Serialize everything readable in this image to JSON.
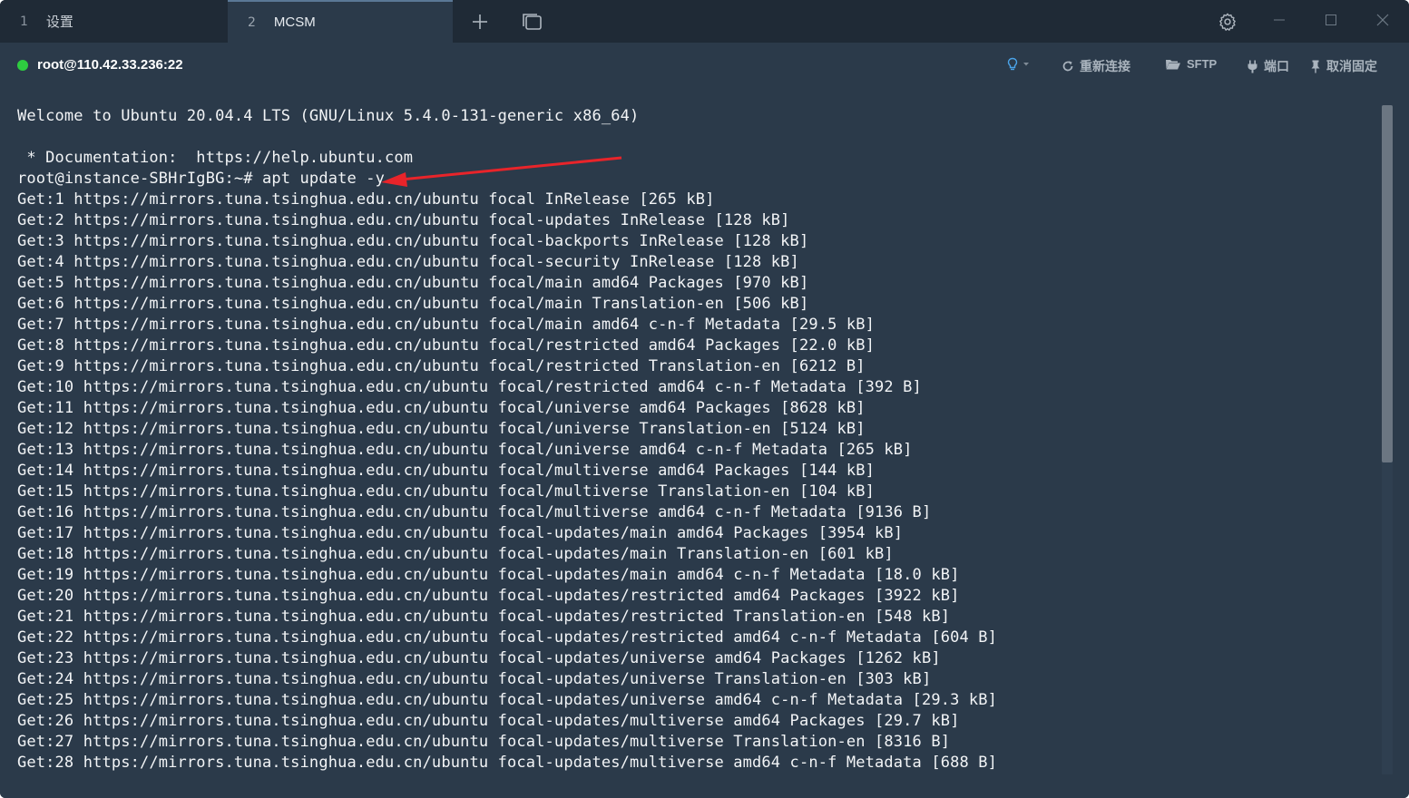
{
  "tabs": [
    {
      "index": "1",
      "label": "设置"
    },
    {
      "index": "2",
      "label": "MCSM"
    }
  ],
  "tabbar": {
    "new_tab_icon": "plus-icon",
    "split_icon": "window-copy-icon",
    "settings_icon": "gear-icon"
  },
  "toolbar": {
    "host": "root@110.42.33.236:22",
    "status_color": "#2ecc40",
    "reconnect_label": "重新连接",
    "sftp_label": "SFTP",
    "port_label": "端口",
    "unpin_label": "取消固定"
  },
  "terminal": {
    "lines": [
      "Welcome to Ubuntu 20.04.4 LTS (GNU/Linux 5.4.0-131-generic x86_64)",
      "",
      " * Documentation:  https://help.ubuntu.com",
      "root@instance-SBHrIgBG:~# apt update -y",
      "Get:1 https://mirrors.tuna.tsinghua.edu.cn/ubuntu focal InRelease [265 kB]",
      "Get:2 https://mirrors.tuna.tsinghua.edu.cn/ubuntu focal-updates InRelease [128 kB]",
      "Get:3 https://mirrors.tuna.tsinghua.edu.cn/ubuntu focal-backports InRelease [128 kB]",
      "Get:4 https://mirrors.tuna.tsinghua.edu.cn/ubuntu focal-security InRelease [128 kB]",
      "Get:5 https://mirrors.tuna.tsinghua.edu.cn/ubuntu focal/main amd64 Packages [970 kB]",
      "Get:6 https://mirrors.tuna.tsinghua.edu.cn/ubuntu focal/main Translation-en [506 kB]",
      "Get:7 https://mirrors.tuna.tsinghua.edu.cn/ubuntu focal/main amd64 c-n-f Metadata [29.5 kB]",
      "Get:8 https://mirrors.tuna.tsinghua.edu.cn/ubuntu focal/restricted amd64 Packages [22.0 kB]",
      "Get:9 https://mirrors.tuna.tsinghua.edu.cn/ubuntu focal/restricted Translation-en [6212 B]",
      "Get:10 https://mirrors.tuna.tsinghua.edu.cn/ubuntu focal/restricted amd64 c-n-f Metadata [392 B]",
      "Get:11 https://mirrors.tuna.tsinghua.edu.cn/ubuntu focal/universe amd64 Packages [8628 kB]",
      "Get:12 https://mirrors.tuna.tsinghua.edu.cn/ubuntu focal/universe Translation-en [5124 kB]",
      "Get:13 https://mirrors.tuna.tsinghua.edu.cn/ubuntu focal/universe amd64 c-n-f Metadata [265 kB]",
      "Get:14 https://mirrors.tuna.tsinghua.edu.cn/ubuntu focal/multiverse amd64 Packages [144 kB]",
      "Get:15 https://mirrors.tuna.tsinghua.edu.cn/ubuntu focal/multiverse Translation-en [104 kB]",
      "Get:16 https://mirrors.tuna.tsinghua.edu.cn/ubuntu focal/multiverse amd64 c-n-f Metadata [9136 B]",
      "Get:17 https://mirrors.tuna.tsinghua.edu.cn/ubuntu focal-updates/main amd64 Packages [3954 kB]",
      "Get:18 https://mirrors.tuna.tsinghua.edu.cn/ubuntu focal-updates/main Translation-en [601 kB]",
      "Get:19 https://mirrors.tuna.tsinghua.edu.cn/ubuntu focal-updates/main amd64 c-n-f Metadata [18.0 kB]",
      "Get:20 https://mirrors.tuna.tsinghua.edu.cn/ubuntu focal-updates/restricted amd64 Packages [3922 kB]",
      "Get:21 https://mirrors.tuna.tsinghua.edu.cn/ubuntu focal-updates/restricted Translation-en [548 kB]",
      "Get:22 https://mirrors.tuna.tsinghua.edu.cn/ubuntu focal-updates/restricted amd64 c-n-f Metadata [604 B]",
      "Get:23 https://mirrors.tuna.tsinghua.edu.cn/ubuntu focal-updates/universe amd64 Packages [1262 kB]",
      "Get:24 https://mirrors.tuna.tsinghua.edu.cn/ubuntu focal-updates/universe Translation-en [303 kB]",
      "Get:25 https://mirrors.tuna.tsinghua.edu.cn/ubuntu focal-updates/universe amd64 c-n-f Metadata [29.3 kB]",
      "Get:26 https://mirrors.tuna.tsinghua.edu.cn/ubuntu focal-updates/multiverse amd64 Packages [29.7 kB]",
      "Get:27 https://mirrors.tuna.tsinghua.edu.cn/ubuntu focal-updates/multiverse Translation-en [8316 B]",
      "Get:28 https://mirrors.tuna.tsinghua.edu.cn/ubuntu focal-updates/multiverse amd64 c-n-f Metadata [688 B]"
    ],
    "annotation_arrow_color": "#e8242a",
    "scroll_position": 0.0
  }
}
